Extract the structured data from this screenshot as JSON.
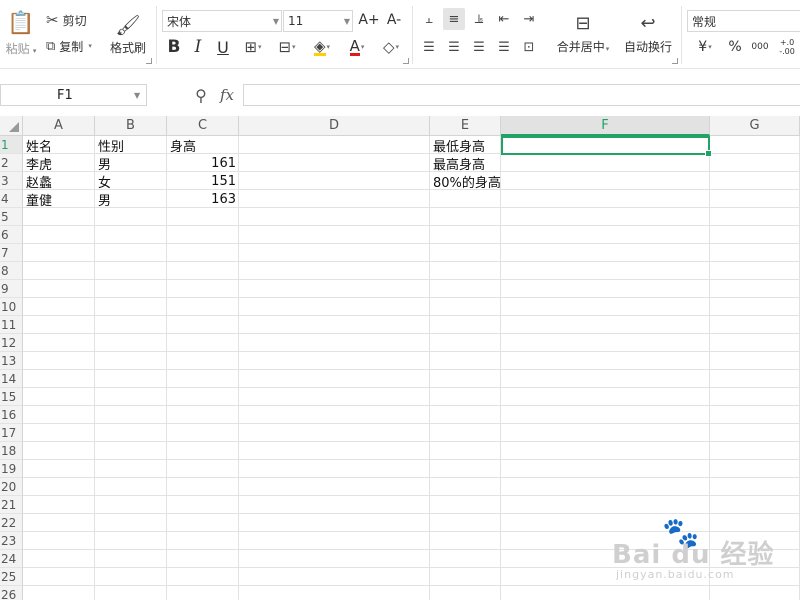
{
  "ribbon": {
    "paste_label": "粘贴",
    "cut_label": "剪切",
    "copy_label": "复制",
    "format_painter_label": "格式刷",
    "font_name": "宋体",
    "font_size": "11",
    "merge_label": "合并居中",
    "wrap_label": "自动换行",
    "number_format": "常规",
    "currency_symbol": "¥",
    "percent_symbol": "%",
    "thousands_symbol": "000",
    "increase_decimal_symbol": "+.0",
    "decrease_decimal_symbol": "-.00",
    "bold_glyph": "B",
    "italic_glyph": "I",
    "underline_glyph": "U",
    "font_color_glyph": "A",
    "grow_font_glyph": "A+",
    "shrink_font_glyph": "A-"
  },
  "formula_bar": {
    "name_box": "F1",
    "fx_label": "fx",
    "formula_value": ""
  },
  "columns": [
    "A",
    "B",
    "C",
    "D",
    "E",
    "F",
    "G"
  ],
  "rows": [
    "1",
    "2",
    "3",
    "4",
    "5",
    "6",
    "7",
    "8",
    "9",
    "10",
    "11",
    "12",
    "13",
    "14",
    "15",
    "16",
    "17",
    "18",
    "19",
    "20",
    "21",
    "22",
    "23",
    "24",
    "25",
    "26"
  ],
  "cells": {
    "A1": "姓名",
    "B1": "性别",
    "C1": "身高",
    "A2": "李虎",
    "B2": "男",
    "C2": "161",
    "A3": "赵蠡",
    "B3": "女",
    "C3": "151",
    "A4": "童健",
    "B4": "男",
    "C4": "163",
    "E1": "最低身高",
    "E2": "最高身高",
    "E3": "80%的身高"
  },
  "selection": {
    "cell": "F1",
    "column": "F",
    "row": "1"
  },
  "colors": {
    "accent": "#21a366",
    "grid": "#e2e2e2",
    "header_bg": "#f3f3f3"
  },
  "watermark": {
    "brand": "Bai du 经验",
    "sub": "jingyan.baidu.com"
  }
}
